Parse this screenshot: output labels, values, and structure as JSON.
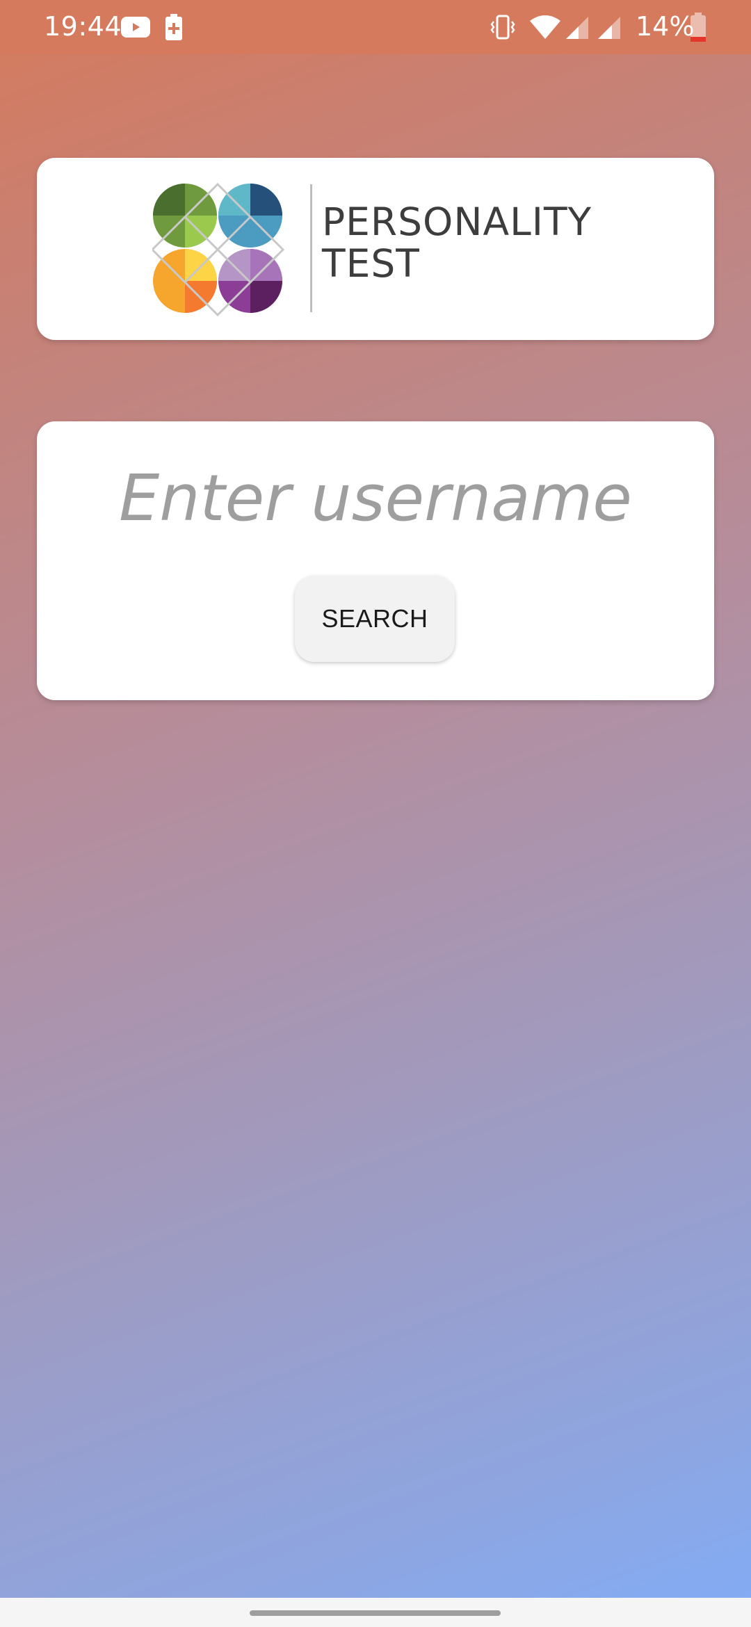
{
  "status_bar": {
    "time": "19:44",
    "battery_percent": "14%",
    "icons": [
      "youtube-icon",
      "battery-charging-icon",
      "vibrate-icon",
      "wifi-icon",
      "signal-icon",
      "signal-icon",
      "battery-low-icon"
    ]
  },
  "logo": {
    "line1": "PERSONALITY",
    "line2": "TEST",
    "colors": [
      "#4f7a34",
      "#3b6a96",
      "#f6a52d",
      "#8a4a9c"
    ]
  },
  "search": {
    "placeholder": "Enter username",
    "button_label": "SEARCH"
  }
}
